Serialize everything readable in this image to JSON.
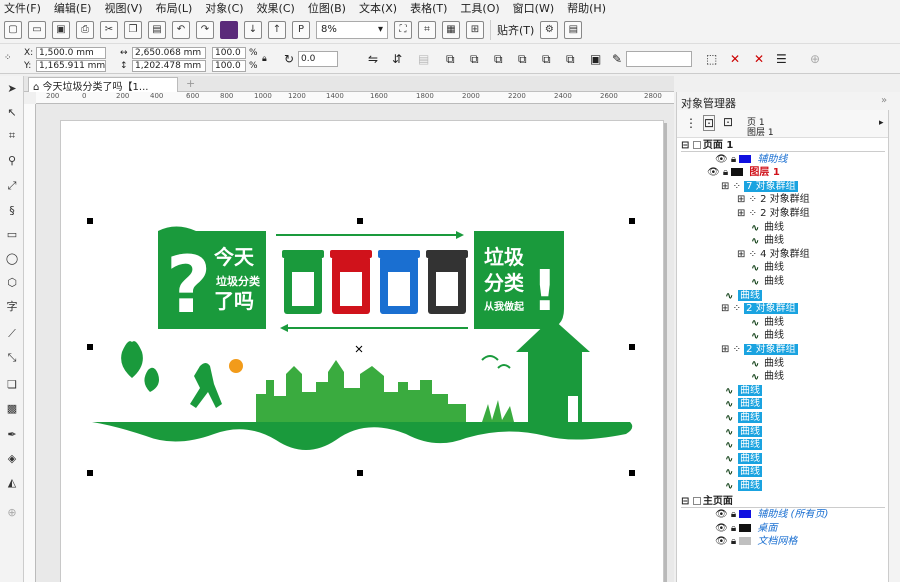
{
  "menu": [
    "文件(F)",
    "编辑(E)",
    "视图(V)",
    "布局(L)",
    "对象(C)",
    "效果(C)",
    "位图(B)",
    "文本(X)",
    "表格(T)",
    "工具(O)",
    "窗口(W)",
    "帮助(H)"
  ],
  "toolbar": {
    "zoom": "8%",
    "snap_label": "贴齐(T)"
  },
  "props": {
    "x": "1,500.0 mm",
    "y": "1,165.911 mm",
    "w": "2,650.068 mm",
    "h": "1,202.478 mm",
    "sx": "100.0",
    "sy": "100.0",
    "pct": "%",
    "rot": "0.0"
  },
  "doc_tab": "今天垃圾分类了吗【1...",
  "ruler_labels": [
    "400",
    "200",
    "0",
    "200",
    "400",
    "600",
    "800",
    "1000",
    "1200",
    "1400",
    "1600",
    "1800",
    "2000",
    "2200",
    "2400",
    "2600",
    "2800",
    "3000"
  ],
  "artwork": {
    "left_big": "?",
    "left_l1": "今天",
    "left_l2": "垃圾分类",
    "left_l3": "了吗",
    "right_l1": "垃圾",
    "right_l2": "分类",
    "right_l3": "从我做起",
    "right_mark": "!",
    "colors": {
      "green": "#1a9a3c",
      "light_green": "#7cc243",
      "red": "#d0121b",
      "blue": "#1a6fd1",
      "black": "#333333",
      "sun": "#f29b1a"
    }
  },
  "panel": {
    "title": "对象管理器",
    "page_label": "页 1",
    "layer_label": "图层 1",
    "rows": [
      {
        "text": "页面 1",
        "type": "page"
      },
      {
        "text": "辅助线",
        "type": "layer-guides"
      },
      {
        "text": "图层 1",
        "type": "layer-active"
      },
      {
        "text": "7 对象群组",
        "type": "group-hl"
      },
      {
        "text": "2 对象群组",
        "type": "group"
      },
      {
        "text": "2 对象群组",
        "type": "group"
      },
      {
        "text": "曲线",
        "type": "curve"
      },
      {
        "text": "曲线",
        "type": "curve"
      },
      {
        "text": "4 对象群组",
        "type": "group"
      },
      {
        "text": "曲线",
        "type": "curve"
      },
      {
        "text": "曲线",
        "type": "curve"
      },
      {
        "text": "曲线",
        "type": "curve-hl"
      },
      {
        "text": "2 对象群组",
        "type": "group-hl"
      },
      {
        "text": "曲线",
        "type": "curve"
      },
      {
        "text": "曲线",
        "type": "curve"
      },
      {
        "text": "2 对象群组",
        "type": "group-hl"
      },
      {
        "text": "曲线",
        "type": "curve"
      },
      {
        "text": "曲线",
        "type": "curve"
      },
      {
        "text": "曲线",
        "type": "curve-hl"
      },
      {
        "text": "曲线",
        "type": "curve-hl"
      },
      {
        "text": "曲线",
        "type": "curve-hl"
      },
      {
        "text": "曲线",
        "type": "curve-hl"
      },
      {
        "text": "曲线",
        "type": "curve-hl"
      },
      {
        "text": "曲线",
        "type": "curve-hl"
      },
      {
        "text": "曲线",
        "type": "curve-hl"
      },
      {
        "text": "曲线",
        "type": "curve-hl"
      },
      {
        "text": "主页面",
        "type": "page"
      },
      {
        "text": "辅助线 (所有页)",
        "type": "master-guides"
      },
      {
        "text": "桌面",
        "type": "master-desktop"
      },
      {
        "text": "文档网格",
        "type": "master-grid"
      }
    ]
  }
}
